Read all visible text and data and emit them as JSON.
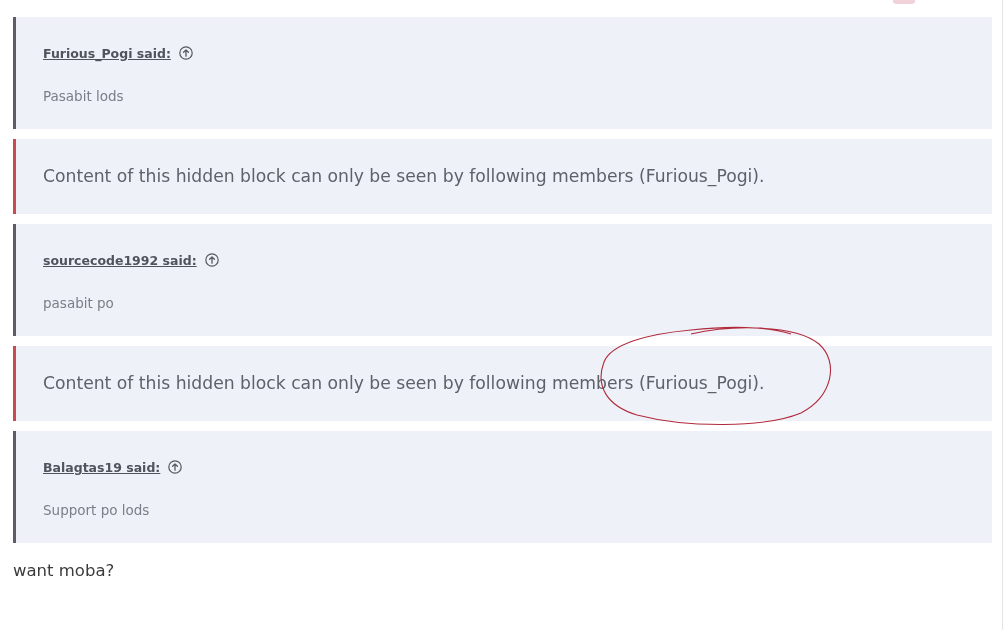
{
  "posts": [
    {
      "kind": "quote",
      "author": "Furious_Pogi said:",
      "body": "Pasabit lods"
    },
    {
      "kind": "hidden",
      "text": "Content of this hidden block can only be seen by following members (Furious_Pogi).",
      "circled": false
    },
    {
      "kind": "quote",
      "author": "sourcecode1992 said:",
      "body": "pasabit po"
    },
    {
      "kind": "hidden",
      "text": "Content of this hidden block can only be seen by following members (Furious_Pogi).",
      "circled": true
    },
    {
      "kind": "quote",
      "author": "Balagtas19 said:",
      "body": "Support po lods"
    }
  ],
  "message": "want moba?"
}
